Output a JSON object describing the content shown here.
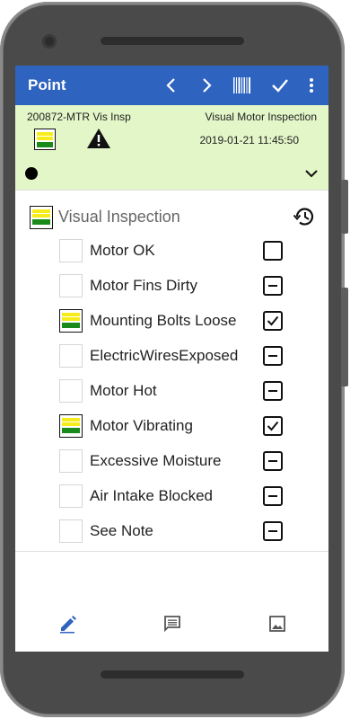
{
  "appbar": {
    "title": "Point",
    "icons": [
      "chevron-left-icon",
      "chevron-right-icon",
      "barcode-icon",
      "check-icon",
      "more-vert-icon"
    ]
  },
  "header": {
    "point_code": "200872-MTR Vis Insp",
    "point_name": "Visual Motor Inspection",
    "datetime": "2019-01-21 11:45:50"
  },
  "section": {
    "title": "Visual Inspection"
  },
  "items": [
    {
      "label": "Motor OK",
      "flagged": false,
      "control": "unchecked"
    },
    {
      "label": "Motor Fins Dirty",
      "flagged": false,
      "control": "indeterminate"
    },
    {
      "label": "Mounting Bolts Loose",
      "flagged": true,
      "control": "checked"
    },
    {
      "label": "ElectricWiresExposed",
      "flagged": false,
      "control": "indeterminate"
    },
    {
      "label": "Motor Hot",
      "flagged": false,
      "control": "indeterminate"
    },
    {
      "label": "Motor Vibrating",
      "flagged": true,
      "control": "checked"
    },
    {
      "label": "Excessive Moisture",
      "flagged": false,
      "control": "indeterminate"
    },
    {
      "label": "Air Intake Blocked",
      "flagged": false,
      "control": "indeterminate"
    },
    {
      "label": "See Note",
      "flagged": false,
      "control": "indeterminate"
    }
  ],
  "bottom_bar": {
    "icons": [
      "edit-icon",
      "comment-icon",
      "image-icon"
    ]
  },
  "colors": {
    "appbar": "#2e64bf",
    "header_bg": "#e3f6c8",
    "status_yellow": "#f5ec1a",
    "status_green": "#1a8a1a",
    "edit_icon": "#2e64bf"
  }
}
